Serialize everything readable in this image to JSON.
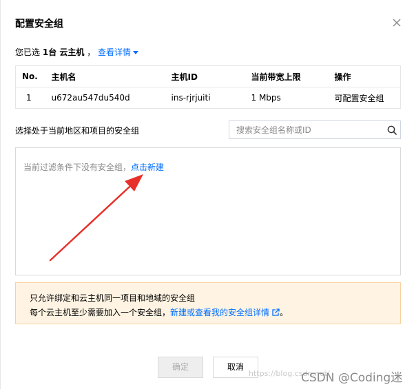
{
  "dialog": {
    "title": "配置安全组",
    "selected_prefix": "您已选",
    "selected_count": "1台 云主机",
    "selected_comma": "，",
    "view_details": "查看详情"
  },
  "table": {
    "headers": [
      "No.",
      "主机名",
      "主机ID",
      "当前带宽上限",
      "操作"
    ],
    "rows": [
      [
        "1",
        "u672au547du540d",
        "ins-rjrjuiti",
        "1 Mbps",
        "可配置安全组"
      ]
    ]
  },
  "security_groups": {
    "select_label": "选择处于当前地区和项目的安全组",
    "search_placeholder": "搜索安全组名称或ID",
    "empty_text": "当前过滤条件下没有安全组，",
    "create_link": "点击新建"
  },
  "notice": {
    "line1": "只允许绑定和云主机同一项目和地域的安全组",
    "line2_prefix": "每个云主机至少需要加入一个安全组，",
    "line2_link": "新建或查看我的安全组详情",
    "line2_suffix": "。"
  },
  "footer": {
    "ok_label": "确定",
    "cancel_label": "取消"
  },
  "watermark": {
    "faint": "https://blog.csdn.net/",
    "main": "CSDN @Coding迷"
  },
  "colors": {
    "link": "#006eff",
    "notice_bg": "#fff4e3",
    "notice_border": "#f7d2a0",
    "annotation_arrow": "#e8302a"
  },
  "icons": {
    "close": "close-icon",
    "caret": "caret-down-icon",
    "search": "search-icon",
    "external": "external-link-icon",
    "arrow": "red-annotation-arrow"
  }
}
